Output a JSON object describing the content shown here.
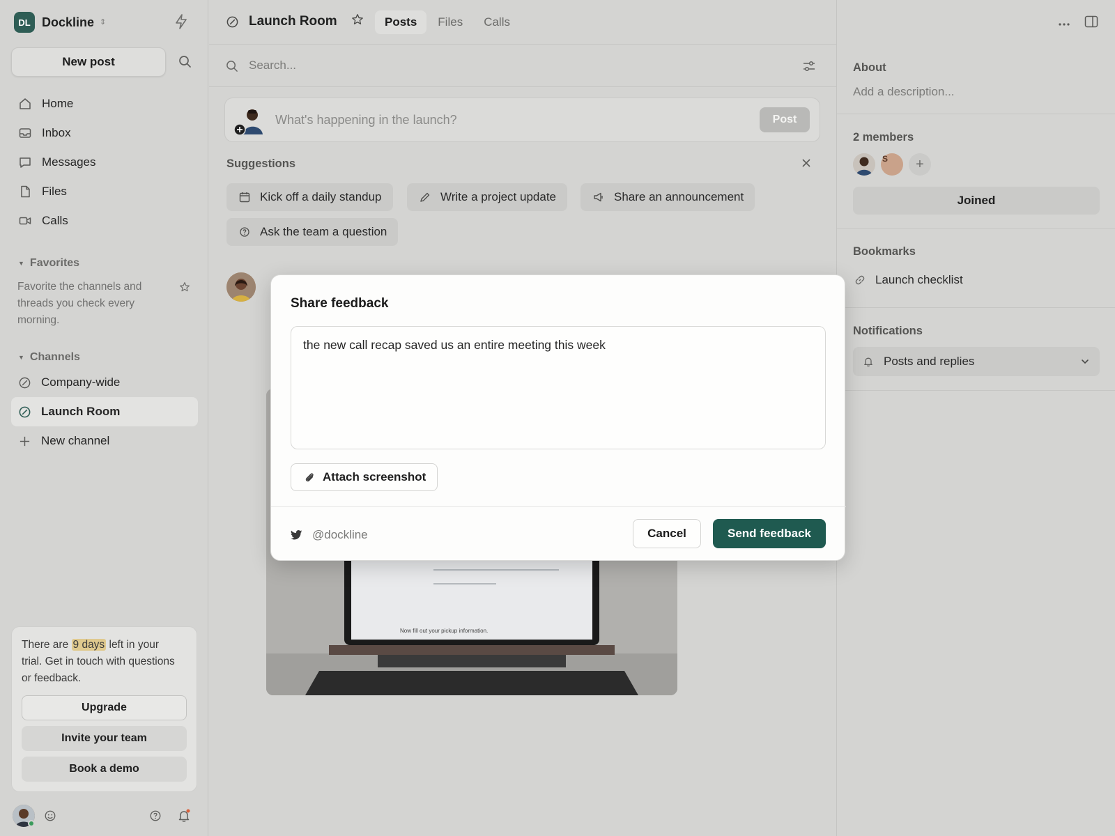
{
  "workspace": {
    "initials": "DL",
    "name": "Dockline"
  },
  "sidebar": {
    "new_post_label": "New post",
    "nav": [
      {
        "label": "Home",
        "icon": "home-icon"
      },
      {
        "label": "Inbox",
        "icon": "inbox-icon"
      },
      {
        "label": "Messages",
        "icon": "message-icon"
      },
      {
        "label": "Files",
        "icon": "file-icon"
      },
      {
        "label": "Calls",
        "icon": "video-icon"
      }
    ],
    "favorites_heading": "Favorites",
    "favorites_hint": "Favorite the channels and threads you check every morning.",
    "channels_heading": "Channels",
    "channels": [
      {
        "label": "Company-wide",
        "active": false
      },
      {
        "label": "Launch Room",
        "active": true
      }
    ],
    "new_channel_label": "New channel",
    "trial": {
      "text_before": "There are ",
      "highlight": "9 days",
      "text_after": " left in your trial. Get in touch with questions or feedback.",
      "upgrade_label": "Upgrade",
      "invite_label": "Invite your team",
      "demo_label": "Book a demo"
    }
  },
  "header": {
    "channel_name": "Launch Room",
    "tabs": [
      {
        "label": "Posts",
        "active": true
      },
      {
        "label": "Files",
        "active": false
      },
      {
        "label": "Calls",
        "active": false
      }
    ]
  },
  "search": {
    "placeholder": "Search..."
  },
  "composer": {
    "placeholder": "What's happening in the launch?",
    "post_label": "Post"
  },
  "suggestions": {
    "heading": "Suggestions",
    "items": [
      {
        "label": "Kick off a daily standup",
        "icon": "calendar-icon"
      },
      {
        "label": "Write a project update",
        "icon": "pencil-icon"
      },
      {
        "label": "Share an announcement",
        "icon": "megaphone-icon"
      },
      {
        "label": "Ask the team a question",
        "icon": "question-icon"
      }
    ]
  },
  "post": {
    "image_caption": "Now fill out your pickup information."
  },
  "right_panel": {
    "about_heading": "About",
    "about_placeholder": "Add a description...",
    "members_heading": "2 members",
    "member2_initial": "S",
    "joined_label": "Joined",
    "bookmarks_heading": "Bookmarks",
    "bookmark_label": "Launch checklist",
    "notifications_heading": "Notifications",
    "notifications_value": "Posts and replies"
  },
  "modal": {
    "title": "Share feedback",
    "message": "the new call recap saved us an entire meeting this week",
    "attach_label": "Attach screenshot",
    "twitter_handle": "@dockline",
    "cancel_label": "Cancel",
    "send_label": "Send feedback"
  },
  "colors": {
    "accent": "#1f5a50",
    "workspace_logo": "#2e5d55",
    "highlight": "#dfc98e"
  }
}
